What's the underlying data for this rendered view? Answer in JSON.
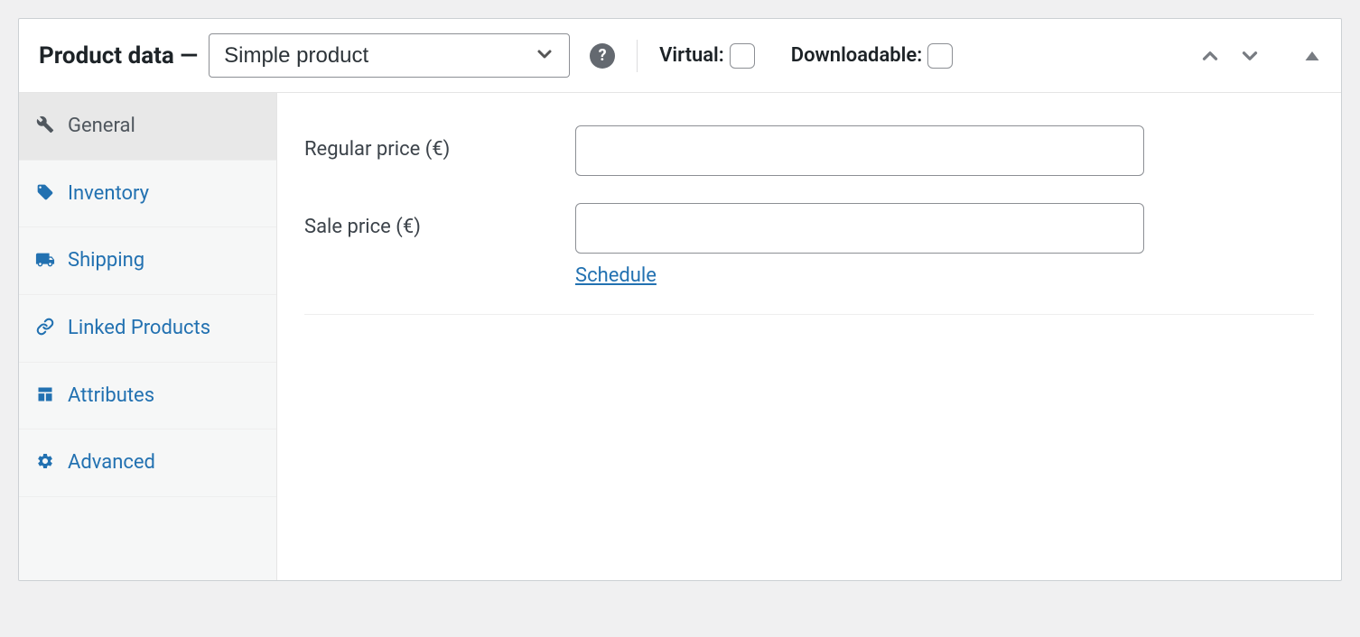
{
  "header": {
    "title": "Product data —",
    "product_type_selected": "Simple product",
    "virtual_label": "Virtual:",
    "downloadable_label": "Downloadable:"
  },
  "sidebar": {
    "items": [
      {
        "label": "General",
        "icon": "wrench",
        "active": true
      },
      {
        "label": "Inventory",
        "icon": "tag",
        "active": false
      },
      {
        "label": "Shipping",
        "icon": "truck",
        "active": false
      },
      {
        "label": "Linked Products",
        "icon": "link",
        "active": false
      },
      {
        "label": "Attributes",
        "icon": "layout",
        "active": false
      },
      {
        "label": "Advanced",
        "icon": "gear",
        "active": false
      }
    ]
  },
  "general": {
    "regular_price_label": "Regular price (€)",
    "regular_price_value": "",
    "sale_price_label": "Sale price (€)",
    "sale_price_value": "",
    "schedule_label": "Schedule"
  },
  "icons": {
    "help": "?"
  }
}
